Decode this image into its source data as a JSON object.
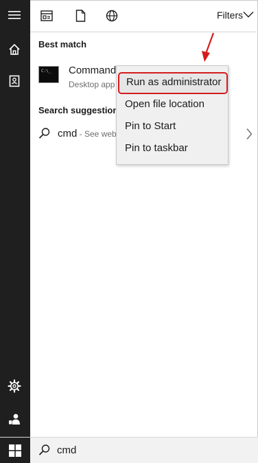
{
  "header": {
    "icons": [
      "apps-icon",
      "document-icon",
      "web-icon"
    ],
    "filters_label": "Filters"
  },
  "best_match": {
    "title": "Best match",
    "app_name": "Command",
    "app_sub": "Desktop app"
  },
  "suggestions": {
    "title": "Search suggestions",
    "item_query": "cmd",
    "item_tail": " - See web"
  },
  "context_menu": {
    "items": [
      {
        "label": "Run as administrator",
        "highlighted": true
      },
      {
        "label": "Open file location"
      },
      {
        "label": "Pin to Start"
      },
      {
        "label": "Pin to taskbar"
      }
    ]
  },
  "rail": {
    "icons": [
      "hamburger-icon",
      "home-icon",
      "contact-icon",
      "settings-icon",
      "user-icon"
    ]
  },
  "searchbar": {
    "query": "cmd"
  },
  "colors": {
    "rail": "#1f1f1f",
    "highlight": "#d31c1c"
  }
}
